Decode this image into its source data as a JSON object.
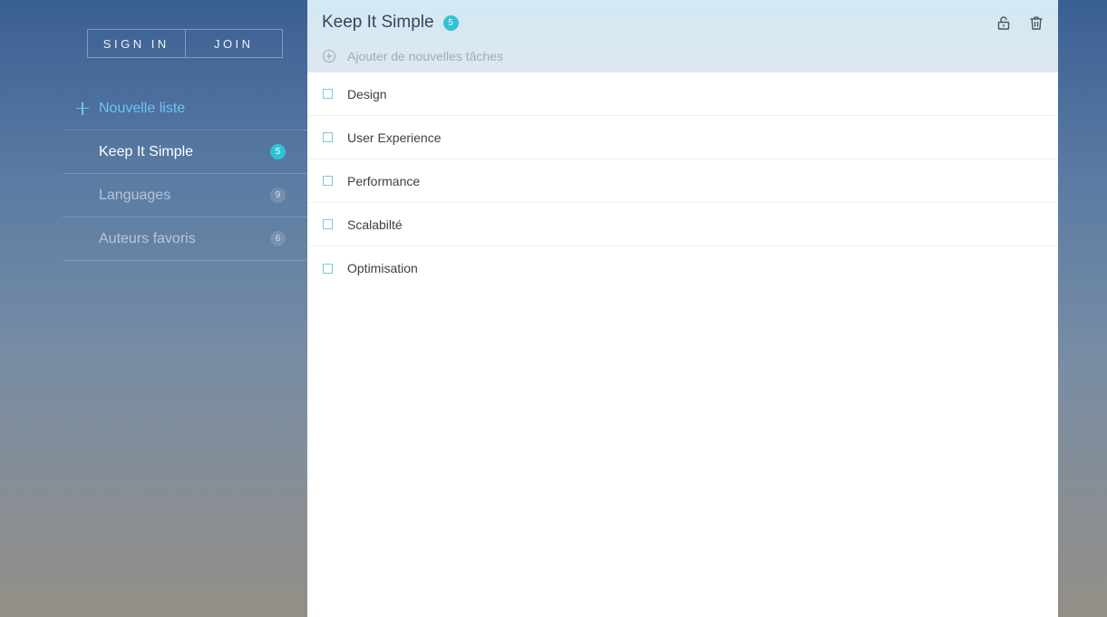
{
  "auth": {
    "sign_in": "SIGN IN",
    "join": "JOIN"
  },
  "sidebar": {
    "new_list_label": "Nouvelle liste",
    "lists": [
      {
        "name": "Keep It Simple",
        "count": "5",
        "active": true
      },
      {
        "name": "Languages",
        "count": "9",
        "active": false
      },
      {
        "name": "Auteurs favoris",
        "count": "6",
        "active": false
      }
    ]
  },
  "main": {
    "title": "Keep It Simple",
    "count": "5",
    "add_task_placeholder": "Ajouter de nouvelles tâches",
    "actions": [
      "lock-open-icon",
      "trash-icon"
    ],
    "tasks": [
      {
        "label": "Design",
        "done": false
      },
      {
        "label": "User Experience",
        "done": false
      },
      {
        "label": "Performance",
        "done": false
      },
      {
        "label": "Scalabilté",
        "done": false
      },
      {
        "label": "Optimisation",
        "done": false
      }
    ]
  },
  "colors": {
    "accent": "#2ec3d6",
    "link": "#6ec3f2",
    "checkbox_border": "#79cbd6"
  }
}
